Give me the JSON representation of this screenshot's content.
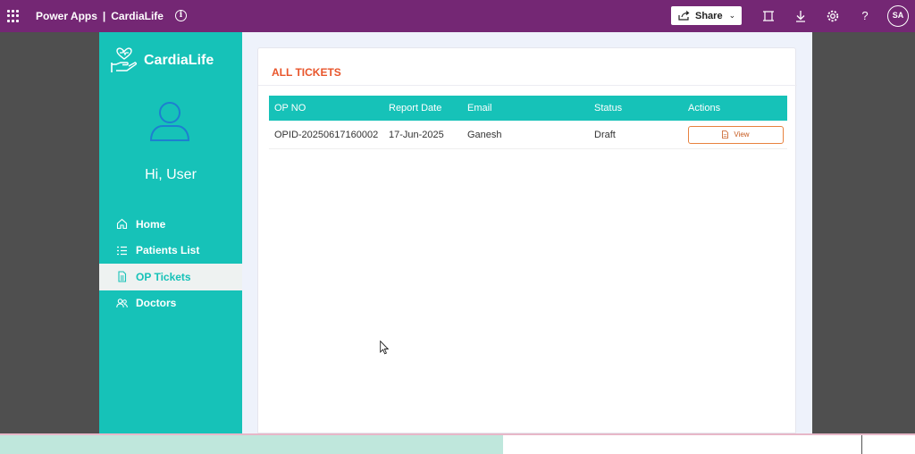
{
  "topbar": {
    "app_name": "Power Apps",
    "separator": "|",
    "app_title": "CardiaLife",
    "share_label": "Share",
    "avatar_initials": "SA"
  },
  "sidebar": {
    "brand": "CardiaLife",
    "greeting": "Hi, User",
    "items": [
      {
        "label": "Home",
        "icon": "home-icon"
      },
      {
        "label": "Patients List",
        "icon": "list-icon"
      },
      {
        "label": "OP Tickets",
        "icon": "document-icon",
        "active": true
      },
      {
        "label": "Doctors",
        "icon": "people-icon"
      }
    ]
  },
  "main": {
    "title": "ALL TICKETS",
    "columns": [
      "OP NO",
      "Report Date",
      "Email",
      "Status",
      "Actions"
    ],
    "rows": [
      {
        "op_no": "OPID-20250617160002",
        "report_date": "17-Jun-2025",
        "email": "Ganesh",
        "status": "Draft",
        "action": "View"
      }
    ]
  },
  "colors": {
    "topbar": "#742774",
    "accent": "#16c2b8",
    "title_orange": "#e8552b"
  }
}
